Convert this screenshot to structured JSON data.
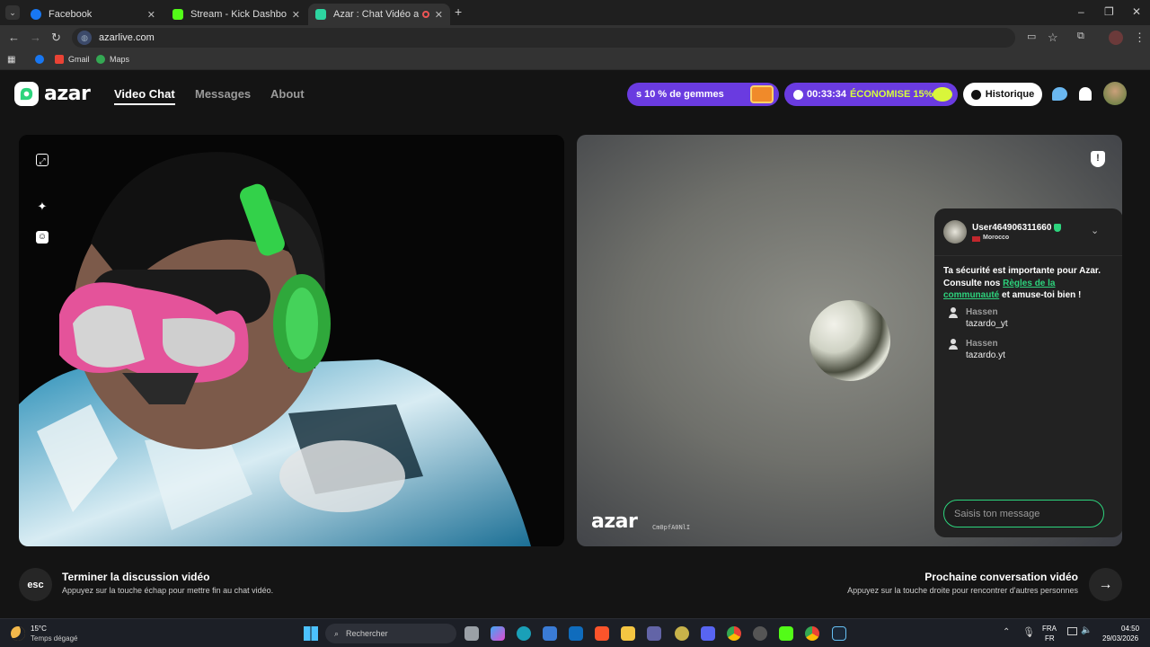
{
  "browser": {
    "tabs": [
      {
        "label": "Facebook",
        "color": "#1877f2"
      },
      {
        "label": "Stream - Kick Dashboard",
        "color": "#53fc18"
      },
      {
        "label": "Azar : Chat Vidéo avec de n",
        "color": "#2dd4a0"
      }
    ],
    "url": "azarlive.com",
    "bookmarks": [
      "Gmail",
      "Maps"
    ]
  },
  "app": {
    "logo": "azar",
    "nav": [
      "Video Chat",
      "Messages",
      "About"
    ],
    "promo_gems": "10 % de gemmes",
    "promo_gems_prefix": "s",
    "timer": "00:33:34",
    "timer_offer": "ÉCONOMISE 15%",
    "history_label": "Historique"
  },
  "remote": {
    "watermark": "azar",
    "watermark_code": "Cm0pfA0NlI"
  },
  "chat": {
    "username": "User464906311660",
    "country": "Morocco",
    "safety_pre": "Ta sécurité est importante pour Azar. Consulte nos ",
    "safety_link": "Règles de la communauté",
    "safety_post": " et amuse-toi bien !",
    "messages": [
      {
        "name": "Hassen",
        "text": "tazardo_yt"
      },
      {
        "name": "Hassen",
        "text": "tazardo.yt"
      }
    ],
    "input_placeholder": "Saisis ton message"
  },
  "footer": {
    "esc_key": "esc",
    "end_title": "Terminer la discussion vidéo",
    "end_sub": "Appuyez sur la touche échap pour mettre fin au chat vidéo.",
    "next_title": "Prochaine conversation vidéo",
    "next_sub": "Appuyez sur la touche droite pour rencontrer d'autres personnes"
  },
  "taskbar": {
    "temp": "15°C",
    "weather": "Temps dégagé",
    "search_placeholder": "Rechercher",
    "lang1": "FRA",
    "lang2": "FR",
    "time": "04:50",
    "date": "29/03/2026"
  },
  "colors": {
    "accent_green": "#2dd47d",
    "promo_purple": "#6a3be0"
  }
}
